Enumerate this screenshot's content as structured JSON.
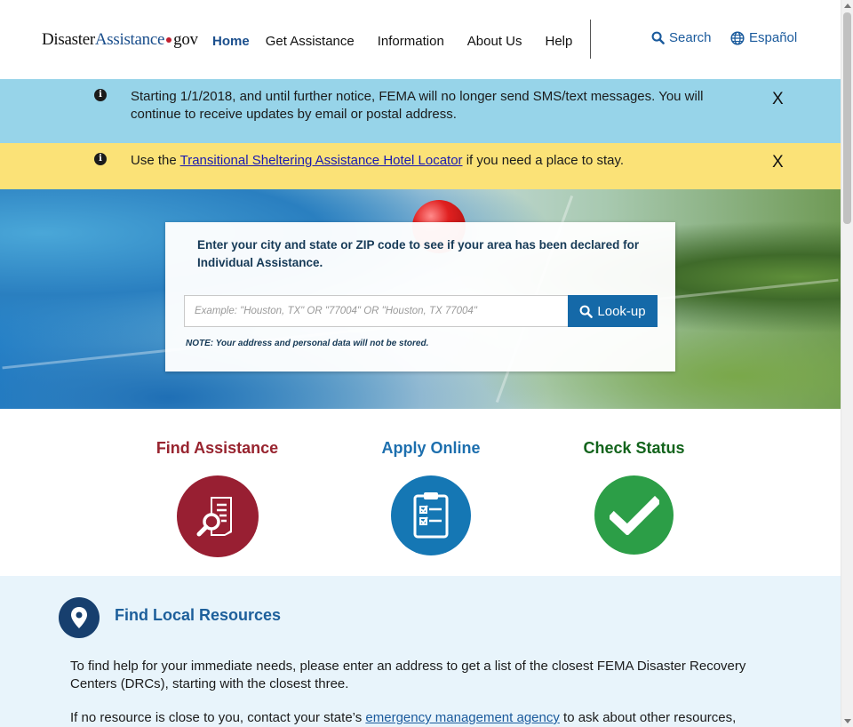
{
  "header": {
    "logo": {
      "part1": "Disaster",
      "part2": "Assistance",
      "part3": "gov"
    },
    "nav": [
      "Home",
      "Get Assistance",
      "Information",
      "About Us",
      "Help"
    ],
    "search_label": "Search",
    "language_label": "Español"
  },
  "banners": {
    "sms": {
      "text": "Starting 1/1/2018, and until further notice, FEMA will no longer send SMS/text messages. You will continue to receive updates by email or postal address.",
      "close": "X"
    },
    "hotel": {
      "prefix": "Use the ",
      "link": "Transitional Sheltering Assistance Hotel Locator",
      "suffix": " if you need a place to stay.",
      "close": "X"
    }
  },
  "lookup": {
    "prompt": "Enter your city and state or ZIP code to see if your area has been declared for Individual Assistance.",
    "placeholder": "Example: \"Houston, TX\" OR \"77004\" OR \"Houston, TX 77004\"",
    "value": "",
    "button": "Look-up",
    "note": "NOTE: Your address and personal data will not be stored."
  },
  "actions": {
    "find": "Find Assistance",
    "apply": "Apply Online",
    "check": "Check Status"
  },
  "resources": {
    "title": "Find Local Resources",
    "p1": "To find help for your immediate needs, please enter an address to get a list of the closest FEMA Disaster Recovery Centers (DRCs), starting with the closest three.",
    "p2_prefix": "If no resource is close to you, contact your state’s ",
    "p2_link": "emergency management agency",
    "p2_suffix": " to ask about other resources,"
  },
  "colors": {
    "brand_blue": "#1a4e8c",
    "banner_blue": "#97d4e9",
    "banner_yellow": "#fbe277",
    "find_red": "#981f32",
    "apply_blue": "#1577b4",
    "check_green": "#2c9e47",
    "resources_bg": "#e8f4fb"
  }
}
